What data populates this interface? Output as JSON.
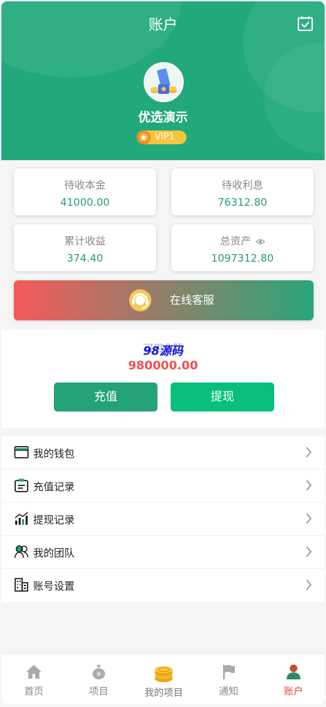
{
  "header": {
    "title": "账户",
    "username": "优选演示",
    "vip_label": "VIP1",
    "bg_color": "#21a97c"
  },
  "stats": [
    {
      "label": "待收本金",
      "value": "41000.00"
    },
    {
      "label": "待收利息",
      "value": "76312.80"
    },
    {
      "label": "累计收益",
      "value": "374.40"
    },
    {
      "label": "总资产",
      "value": "1097312.80"
    }
  ],
  "service": {
    "label": "在线客服"
  },
  "balance": {
    "label": "可用余额",
    "watermark": "98源码",
    "value": "980000.00",
    "recharge_label": "充值",
    "withdraw_label": "提现"
  },
  "menu": [
    {
      "label": "我的钱包",
      "icon": "wallet-icon"
    },
    {
      "label": "充值记录",
      "icon": "clipboard-icon"
    },
    {
      "label": "提现记录",
      "icon": "bar-chart-icon"
    },
    {
      "label": "我的团队",
      "icon": "team-icon"
    },
    {
      "label": "账号设置",
      "icon": "building-icon"
    }
  ],
  "tabbar": [
    {
      "label": "首页",
      "icon": "home-icon"
    },
    {
      "label": "项目",
      "icon": "money-bag-icon"
    },
    {
      "label": "我的项目",
      "icon": "coins-icon"
    },
    {
      "label": "通知",
      "icon": "flag-icon"
    },
    {
      "label": "账户",
      "icon": "user-icon",
      "active": true
    }
  ],
  "colors": {
    "accent": "#21a97c",
    "value_green": "#2a9c72",
    "balance_red": "#f05050",
    "tab_active": "#e24a3b"
  }
}
